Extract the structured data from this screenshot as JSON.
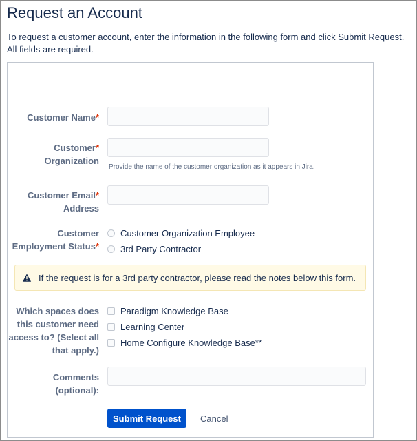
{
  "page": {
    "title": "Request an Account",
    "intro_line1": "To request a customer account, enter the information in the following form and click Submit Request.",
    "intro_line2": "All fields are required."
  },
  "form": {
    "customer_name": {
      "label": "Customer Name",
      "required": "*",
      "value": "",
      "placeholder": ""
    },
    "customer_org": {
      "label_line1": "Customer",
      "label_line2": "Organization",
      "required": "*",
      "value": "",
      "placeholder": "",
      "help": "Provide the name of the customer organization as it appears in Jira."
    },
    "customer_email": {
      "label_line1": "Customer Email",
      "label_line2": "Address",
      "required": "*",
      "value": "",
      "placeholder": ""
    },
    "employment_status": {
      "label_line1": "Customer",
      "label_line2": "Employment Status",
      "required": "*",
      "options": [
        "Customer Organization Employee",
        "3rd Party Contractor"
      ]
    },
    "warning": {
      "icon": "warning-icon",
      "text": "If the request is for a 3rd party contractor, please read the notes below this form."
    },
    "spaces": {
      "label_line1": "Which spaces does",
      "label_line2": "this customer need",
      "label_line3": "access to? (Select all",
      "label_line4": "that apply.)",
      "options": [
        "Paradigm Knowledge Base",
        "Learning Center",
        "Home Configure Knowledge Base**"
      ]
    },
    "comments": {
      "label_line1": "Comments",
      "label_line2": "(optional):",
      "value": "",
      "placeholder": ""
    },
    "submit_label": "Submit Request",
    "cancel_label": "Cancel"
  },
  "colors": {
    "primary": "#0052cc",
    "required": "#de350b",
    "warning_bg": "#fffae6",
    "label": "#5e6c84"
  }
}
